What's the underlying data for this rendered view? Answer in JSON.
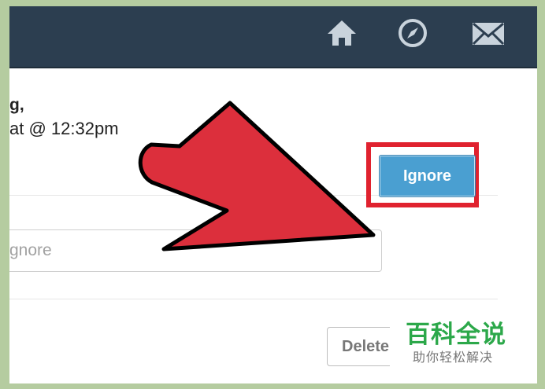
{
  "header": {
    "icons": [
      "home-icon",
      "compass-icon",
      "mail-icon"
    ],
    "background_color": "#2c3e50"
  },
  "post": {
    "date_fragment": "g, ",
    "time_fragment": "at @ 12:32pm"
  },
  "reason_input": {
    "placeholder": "gnore"
  },
  "buttons": {
    "ignore_label": "Ignore",
    "delete_label": "Delete"
  },
  "annotation": {
    "arrow_color": "#dc2f3c",
    "highlight_color": "#e0222f"
  },
  "watermark": {
    "title": "百科全说",
    "subtitle": "助你轻松解决"
  }
}
